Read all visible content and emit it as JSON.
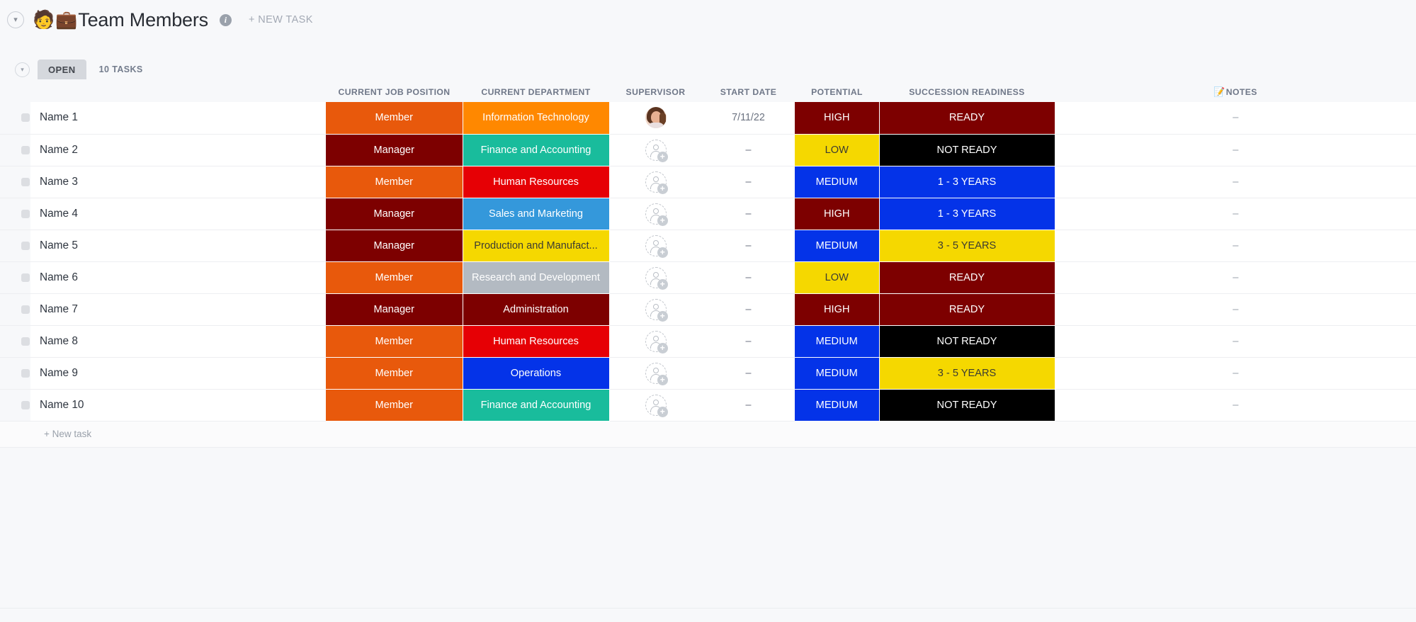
{
  "header": {
    "collapse_icon": "chevron-down-circle",
    "emoji_person": "🧑",
    "emoji_case": "💼",
    "title": "Team Members",
    "info_icon": "i",
    "new_task_label": "+ NEW TASK"
  },
  "group": {
    "collapse_icon": "chevron-down-circle",
    "status_label": "OPEN",
    "task_count": "10 TASKS",
    "new_task_label": "+ New task"
  },
  "columns": {
    "name": "",
    "position": "CURRENT JOB POSITION",
    "department": "CURRENT DEPARTMENT",
    "supervisor": "SUPERVISOR",
    "start_date": "START DATE",
    "potential": "POTENTIAL",
    "succession": "SUCCESSION READINESS",
    "notes_emoji": "📝",
    "notes": "NOTES"
  },
  "colors": {
    "member": "#E8590C",
    "manager": "#7D0000",
    "dept_it": "#FF8800",
    "dept_finance": "#19BC9C",
    "dept_hr": "#E60005",
    "dept_sales": "#3498DB",
    "dept_production": "#F5D800",
    "dept_rnd": "#B3BAC2",
    "dept_admin": "#7D0000",
    "dept_operations": "#0433E8",
    "high": "#7D0000",
    "medium": "#0433E8",
    "low": "#F5D800",
    "ready": "#7D0000",
    "not_ready": "#000000",
    "years_1_3": "#0433E8",
    "years_3_5": "#F5D800",
    "placeholder_dash": "–"
  },
  "rows": [
    {
      "name": "Name 1",
      "position": "Member",
      "position_color": "#E8590C",
      "position_dark": false,
      "department": "Information Technology",
      "department_color": "#FF8800",
      "department_dark": false,
      "supervisor": "photo-avatar",
      "start_date": "7/11/22",
      "potential": "HIGH",
      "potential_color": "#7D0000",
      "potential_dark": false,
      "succession": "READY",
      "succession_color": "#7D0000",
      "succession_dark": false,
      "notes": "–"
    },
    {
      "name": "Name 2",
      "position": "Manager",
      "position_color": "#7D0000",
      "position_dark": false,
      "department": "Finance and Accounting",
      "department_color": "#19BC9C",
      "department_dark": false,
      "supervisor": "add-avatar",
      "start_date": "–",
      "potential": "LOW",
      "potential_color": "#F5D800",
      "potential_dark": true,
      "succession": "NOT READY",
      "succession_color": "#000000",
      "succession_dark": false,
      "notes": "–"
    },
    {
      "name": "Name 3",
      "position": "Member",
      "position_color": "#E8590C",
      "position_dark": false,
      "department": "Human Resources",
      "department_color": "#E60005",
      "department_dark": false,
      "supervisor": "add-avatar",
      "start_date": "–",
      "potential": "MEDIUM",
      "potential_color": "#0433E8",
      "potential_dark": false,
      "succession": "1 - 3 YEARS",
      "succession_color": "#0433E8",
      "succession_dark": false,
      "notes": "–"
    },
    {
      "name": "Name 4",
      "position": "Manager",
      "position_color": "#7D0000",
      "position_dark": false,
      "department": "Sales and Marketing",
      "department_color": "#3498DB",
      "department_dark": false,
      "supervisor": "add-avatar",
      "start_date": "–",
      "potential": "HIGH",
      "potential_color": "#7D0000",
      "potential_dark": false,
      "succession": "1 - 3 YEARS",
      "succession_color": "#0433E8",
      "succession_dark": false,
      "notes": "–"
    },
    {
      "name": "Name 5",
      "position": "Manager",
      "position_color": "#7D0000",
      "position_dark": false,
      "department": "Production and Manufact...",
      "department_color": "#F5D800",
      "department_dark": true,
      "supervisor": "add-avatar",
      "start_date": "–",
      "potential": "MEDIUM",
      "potential_color": "#0433E8",
      "potential_dark": false,
      "succession": "3 - 5 YEARS",
      "succession_color": "#F5D800",
      "succession_dark": true,
      "notes": "–"
    },
    {
      "name": "Name 6",
      "position": "Member",
      "position_color": "#E8590C",
      "position_dark": false,
      "department": "Research and Development",
      "department_color": "#B3BAC2",
      "department_dark": false,
      "supervisor": "add-avatar",
      "start_date": "–",
      "potential": "LOW",
      "potential_color": "#F5D800",
      "potential_dark": true,
      "succession": "READY",
      "succession_color": "#7D0000",
      "succession_dark": false,
      "notes": "–"
    },
    {
      "name": "Name 7",
      "position": "Manager",
      "position_color": "#7D0000",
      "position_dark": false,
      "department": "Administration",
      "department_color": "#7D0000",
      "department_dark": false,
      "supervisor": "add-avatar",
      "start_date": "–",
      "potential": "HIGH",
      "potential_color": "#7D0000",
      "potential_dark": false,
      "succession": "READY",
      "succession_color": "#7D0000",
      "succession_dark": false,
      "notes": "–"
    },
    {
      "name": "Name 8",
      "position": "Member",
      "position_color": "#E8590C",
      "position_dark": false,
      "department": "Human Resources",
      "department_color": "#E60005",
      "department_dark": false,
      "supervisor": "add-avatar",
      "start_date": "–",
      "potential": "MEDIUM",
      "potential_color": "#0433E8",
      "potential_dark": false,
      "succession": "NOT READY",
      "succession_color": "#000000",
      "succession_dark": false,
      "notes": "–"
    },
    {
      "name": "Name 9",
      "position": "Member",
      "position_color": "#E8590C",
      "position_dark": false,
      "department": "Operations",
      "department_color": "#0433E8",
      "department_dark": false,
      "supervisor": "add-avatar",
      "start_date": "–",
      "potential": "MEDIUM",
      "potential_color": "#0433E8",
      "potential_dark": false,
      "succession": "3 - 5 YEARS",
      "succession_color": "#F5D800",
      "succession_dark": true,
      "notes": "–"
    },
    {
      "name": "Name 10",
      "position": "Member",
      "position_color": "#E8590C",
      "position_dark": false,
      "department": "Finance and Accounting",
      "department_color": "#19BC9C",
      "department_dark": false,
      "supervisor": "add-avatar",
      "start_date": "–",
      "potential": "MEDIUM",
      "potential_color": "#0433E8",
      "potential_dark": false,
      "succession": "NOT READY",
      "succession_color": "#000000",
      "succession_dark": false,
      "notes": "–"
    }
  ]
}
